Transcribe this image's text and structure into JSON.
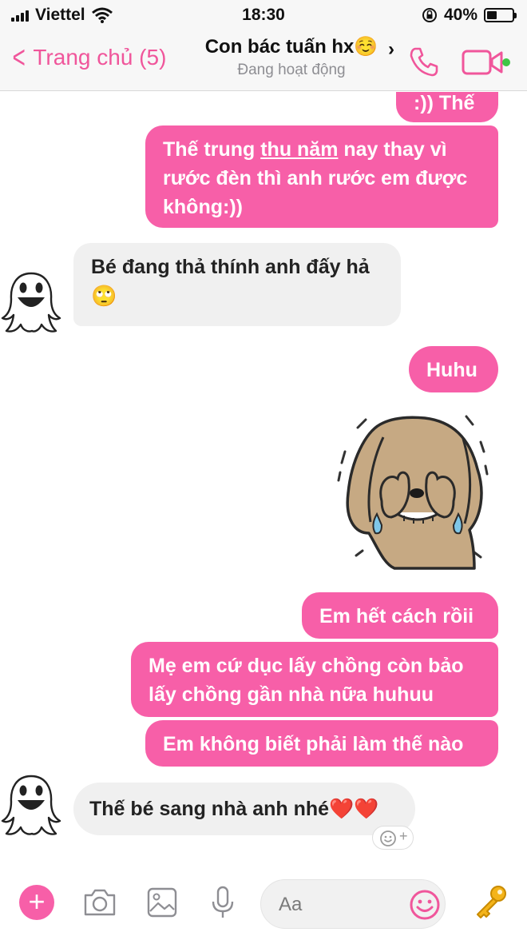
{
  "status_bar": {
    "carrier": "Viettel",
    "time": "18:30",
    "battery": "40%",
    "battery_level": 0.4
  },
  "nav": {
    "back_label": "Trang chủ (5)",
    "title": "Con bác tuấn hx☺️",
    "subtitle": "Đang hoạt động",
    "accent_color": "#f0569b"
  },
  "messages": [
    {
      "from": "me",
      "text": ":)) Thế"
    },
    {
      "from": "me",
      "parts": [
        "Thế trung ",
        "thu năm",
        " nay thay vì"
      ],
      "line2": "rước đèn thì anh rước em được",
      "line3": "không:))"
    },
    {
      "from": "them",
      "text": "Bé đang thả thính anh đấy hả",
      "emoji": "🙄"
    },
    {
      "from": "me",
      "text": "Huhu"
    },
    {
      "from": "me",
      "sticker": "crying-dog-sticker"
    },
    {
      "from": "me",
      "text": "Em hết cách rồii"
    },
    {
      "from": "me",
      "line1": "Mẹ em cứ dục lấy chồng còn bảo",
      "line2": "lấy chồng gần nhà nữa huhuu"
    },
    {
      "from": "me",
      "text": "Em không biết phải làm thế nào"
    },
    {
      "from": "them",
      "text": "Thế bé sang nhà anh nhé",
      "emoji": "❤️❤️"
    }
  ],
  "composer": {
    "placeholder": "Aa",
    "bubble_color": "#f75fa8"
  }
}
